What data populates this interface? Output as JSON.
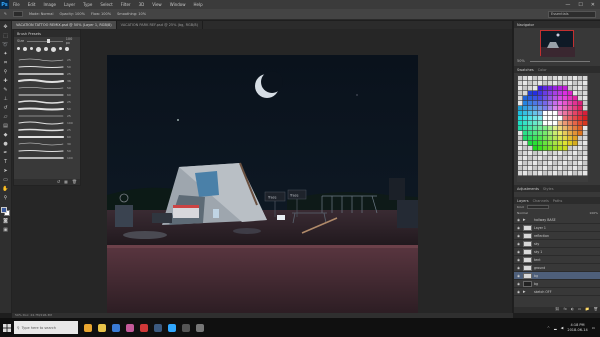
{
  "app": {
    "logo": "Ps",
    "menu": [
      "File",
      "Edit",
      "Image",
      "Layer",
      "Type",
      "Select",
      "Filter",
      "3D",
      "View",
      "Window",
      "Help"
    ],
    "window_controls": [
      "—",
      "☐",
      "✕"
    ]
  },
  "options_bar": {
    "items": [
      "Mode: Normal",
      "Opacity: 100%",
      "Flow: 100%",
      "Smoothing: 10%"
    ],
    "workspace": "Essentials"
  },
  "tabs": [
    {
      "label": "VACATION TATTOO REMIX.psd @ 50% (Layer 1, RGB/8)",
      "active": true
    },
    {
      "label": "VACATION PARK REF.psd @ 25% (bg, RGB/8)",
      "active": false
    }
  ],
  "brush_panel": {
    "title": "Brush Presets",
    "size_label": "Size",
    "size_value": "100 px",
    "stroke_values": [
      "25",
      "50",
      "25",
      "36",
      "50",
      "60",
      "25",
      "50",
      "25",
      "100",
      "25",
      "60",
      "30",
      "50",
      "100"
    ],
    "footer_icons": [
      "↺",
      "▦",
      "🗑"
    ]
  },
  "navigator": {
    "title": "Navigator",
    "zoom": "50%"
  },
  "swatches": {
    "title": "Swatches",
    "tab2": "Color"
  },
  "adjustments": {
    "title": "Adjustments",
    "tab2": "Styles"
  },
  "layers_panel": {
    "title": "Layers",
    "tab2": "Channels",
    "tab3": "Paths",
    "kind_label": "Kind",
    "blend_mode": "Normal",
    "opacity": "100%",
    "layers": [
      {
        "name": "hallway BASE",
        "type": "folder",
        "selected": false
      },
      {
        "name": "Layer 1",
        "type": "layer",
        "selected": false
      },
      {
        "name": "reflection",
        "type": "layer",
        "selected": false
      },
      {
        "name": "sky",
        "type": "layer",
        "selected": false
      },
      {
        "name": "sky 1",
        "type": "layer",
        "selected": false
      },
      {
        "name": "tent",
        "type": "layer",
        "selected": false
      },
      {
        "name": "ground",
        "type": "layer",
        "selected": false
      },
      {
        "name": "bg",
        "type": "layer",
        "selected": true
      },
      {
        "name": "bg",
        "type": "dark",
        "selected": false
      },
      {
        "name": "sketch OFF",
        "type": "folder",
        "selected": false
      }
    ],
    "footer_icons": [
      "⛓",
      "fx",
      "◐",
      "▭",
      "📁",
      "🗑"
    ]
  },
  "canvas_scene": {
    "sign_left": "Trace",
    "sign_right": "Trace",
    "label_small": "Trace"
  },
  "status_bar": {
    "text": "50%    Doc: 24.7M/196.3M"
  },
  "taskbar": {
    "search_placeholder": "Type here to search",
    "time": "4:18 PM",
    "date": "2018-06-14",
    "apps": [
      {
        "name": "chrome",
        "color": "#e9a630"
      },
      {
        "name": "explorer",
        "color": "#e8c34a"
      },
      {
        "name": "media",
        "color": "#3a7bd5"
      },
      {
        "name": "folder",
        "color": "#c45a9a"
      },
      {
        "name": "red-app",
        "color": "#d03838"
      },
      {
        "name": "steam",
        "color": "#3c5a80"
      },
      {
        "name": "photoshop",
        "color": "#31a8ff"
      },
      {
        "name": "app-dark",
        "color": "#555555"
      },
      {
        "name": "app-settings",
        "color": "#777777"
      }
    ]
  }
}
